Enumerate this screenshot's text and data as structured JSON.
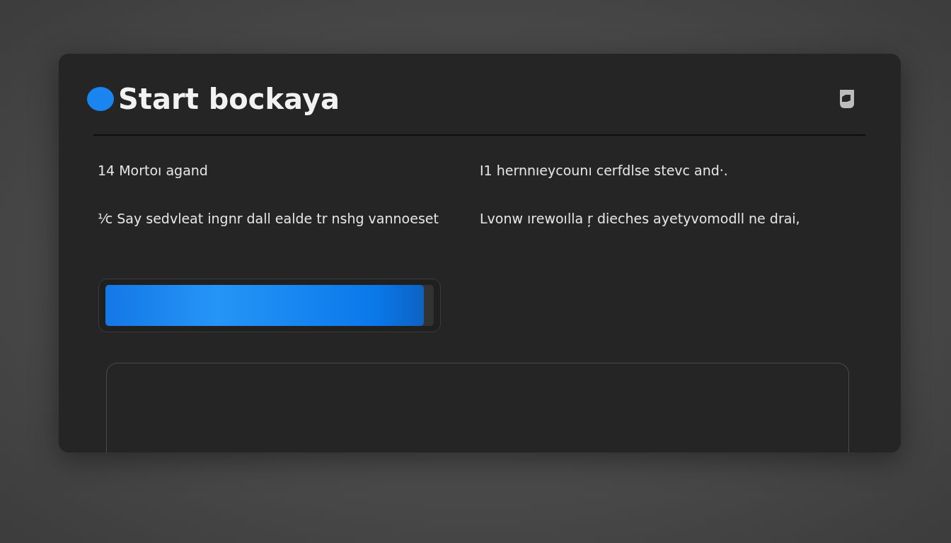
{
  "dialog": {
    "title": "Start bockaya",
    "rows": [
      {
        "left": "14 Mortoı agand",
        "right": "I1 hernnıeycounı cerfdlse stevc and·."
      },
      {
        "left": "⅟c Say sedvleat ingnr dall ealde tr nshg vannoeset",
        "right": "Lvonw ırewoılla ŗ dieches ayetyvomodll ne drai,"
      }
    ],
    "progress": {
      "level": 0.97
    }
  }
}
